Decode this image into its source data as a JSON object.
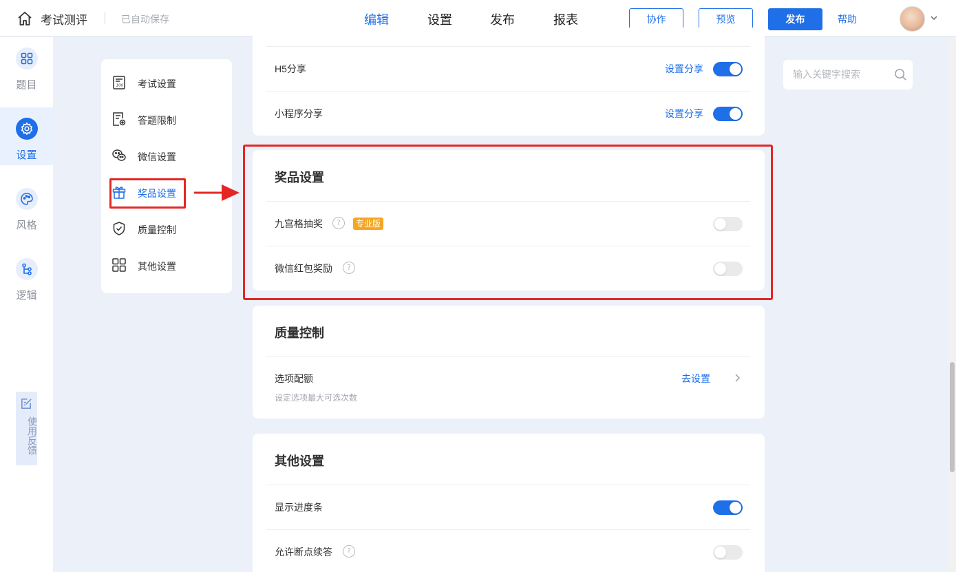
{
  "header": {
    "home_icon": "home-icon",
    "app_title": "考试测评",
    "save_status": "已自动保存",
    "tabs": [
      {
        "label": "编辑",
        "active": true
      },
      {
        "label": "设置",
        "active": false
      },
      {
        "label": "发布",
        "active": false
      },
      {
        "label": "报表",
        "active": false
      }
    ],
    "collaborate_label": "协作",
    "preview_label": "预览",
    "publish_label": "发布",
    "help_label": "帮助",
    "accent_color": "#1e6fe8"
  },
  "rail": {
    "items": [
      {
        "label": "题目",
        "icon": "grid-icon",
        "active": false
      },
      {
        "label": "设置",
        "icon": "gear-icon",
        "active": true
      },
      {
        "label": "风格",
        "icon": "palette-icon",
        "active": false
      },
      {
        "label": "逻辑",
        "icon": "logic-flow-icon",
        "active": false
      }
    ],
    "feedback_label": "使用反馈"
  },
  "submenu": {
    "items": [
      {
        "label": "考试设置",
        "icon": "exam-paper-icon",
        "active": false
      },
      {
        "label": "答题限制",
        "icon": "answer-limit-icon",
        "active": false
      },
      {
        "label": "微信设置",
        "icon": "wechat-icon",
        "active": false
      },
      {
        "label": "奖品设置",
        "icon": "gift-icon",
        "active": true
      },
      {
        "label": "质量控制",
        "icon": "shield-check-icon",
        "active": false
      },
      {
        "label": "其他设置",
        "icon": "apps-icon",
        "active": false
      }
    ]
  },
  "share_card": {
    "rows": [
      {
        "label": "H5分享",
        "action": "设置分享",
        "enabled": true
      },
      {
        "label": "小程序分享",
        "action": "设置分享",
        "enabled": true
      }
    ]
  },
  "prize_card": {
    "title": "奖品设置",
    "rows": [
      {
        "label": "九宫格抽奖",
        "badge": "专业版",
        "enabled": false
      },
      {
        "label": "微信红包奖励",
        "enabled": false
      }
    ]
  },
  "quality_card": {
    "title": "质量控制",
    "row_label": "选项配额",
    "row_sub": "设定选项最大可选次数",
    "row_action": "去设置"
  },
  "other_card": {
    "title": "其他设置",
    "rows": [
      {
        "label": "显示进度条",
        "enabled": true
      },
      {
        "label": "允许断点续答",
        "enabled": false
      }
    ]
  },
  "search": {
    "placeholder": "输入关键字搜索",
    "value": ""
  },
  "highlight_color": "#e52625"
}
